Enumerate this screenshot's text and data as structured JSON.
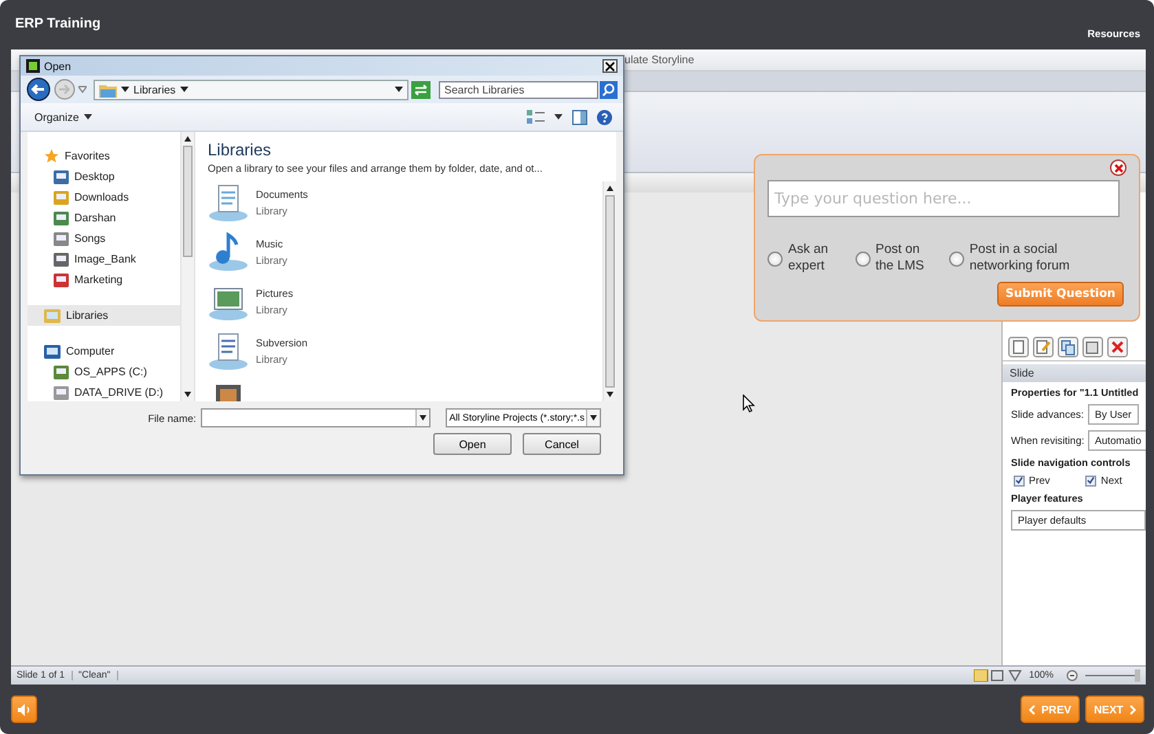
{
  "player": {
    "title": "ERP Training",
    "resources": "Resources"
  },
  "app": {
    "title_fragment": "ulate Storyline",
    "panel": {
      "header": "Slide",
      "properties_title": "Properties for \"1.1 Untitled",
      "advances_label": "Slide advances:",
      "advances_value": "By User",
      "revisiting_label": "When revisiting:",
      "revisiting_value": "Automatio",
      "nav_heading": "Slide navigation controls",
      "nav_controls": [
        {
          "label": "Prev",
          "checked": true
        },
        {
          "label": "Next",
          "checked": true
        }
      ],
      "features_heading": "Player features",
      "features_value": "Player defaults"
    },
    "status_bar": {
      "slide": "Slide 1 of 1",
      "theme": "\"Clean\"",
      "zoom": "100%",
      "zoom_slider": {
        "level": 1
      }
    }
  },
  "open_dialog": {
    "title": "Open",
    "address": "Libraries",
    "search_placeholder": "Search Libraries",
    "organize": "Organize",
    "nav": [
      {
        "label": "Favorites",
        "selected": false,
        "children": [
          {
            "label": "Desktop",
            "selected": false
          },
          {
            "label": "Downloads",
            "selected": false
          },
          {
            "label": "Darshan",
            "selected": false
          },
          {
            "label": "Songs",
            "selected": false
          },
          {
            "label": "Image_Bank",
            "selected": false
          },
          {
            "label": "Marketing",
            "selected": false
          }
        ]
      },
      {
        "label": "Libraries",
        "selected": true
      },
      {
        "label": "Computer",
        "selected": false,
        "children": [
          {
            "label": "OS_APPS (C:)",
            "selected": false
          },
          {
            "label": "DATA_DRIVE (D:)",
            "selected": false
          }
        ]
      }
    ],
    "heading": "Libraries",
    "description": "Open a library to see your files and arrange them by folder, date, and ot...",
    "libraries": [
      {
        "name": "Documents",
        "type": "Library"
      },
      {
        "name": "Music",
        "type": "Library"
      },
      {
        "name": "Pictures",
        "type": "Library"
      },
      {
        "name": "Subversion",
        "type": "Library"
      }
    ],
    "file_name_label": "File name:",
    "filter": "All Storyline Projects (*.story;*.s",
    "open": "Open",
    "cancel": "Cancel"
  },
  "question_popup": {
    "placeholder": "Type your question here...",
    "options": [
      {
        "label": "Ask an expert",
        "selected": false
      },
      {
        "label": "Post on the LMS",
        "selected": false
      },
      {
        "label": "Post in a social networking forum",
        "selected": false
      }
    ],
    "submit": "Submit Question"
  },
  "footer": {
    "prev": "PREV",
    "next": "NEXT"
  }
}
